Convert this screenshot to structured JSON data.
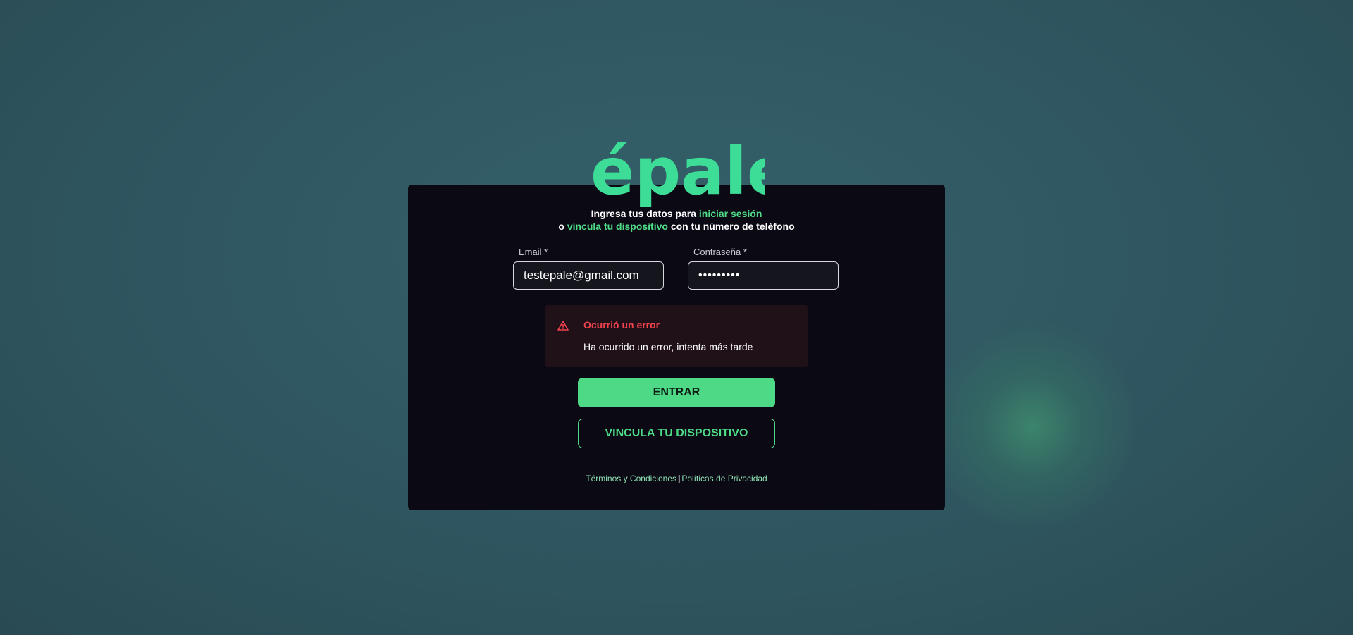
{
  "brand": {
    "logo_text": "épale",
    "accent_color": "#4ed987",
    "logo_color": "#3ddc97"
  },
  "subtitle": {
    "line1_prefix": "Ingresa tus datos para ",
    "line1_highlight": "iniciar sesión",
    "line2_prefix": "o ",
    "line2_highlight": "vincula tu dispositivo",
    "line2_suffix": " con tu número de teléfono"
  },
  "form": {
    "email_label": "Email *",
    "email_value": "testepale@gmail.com",
    "password_label": "Contraseña *",
    "password_value": "•••••••••"
  },
  "error": {
    "icon": "warning-triangle-icon",
    "title": "Ocurrió un error",
    "message": "Ha ocurrido un error, intenta más tarde",
    "color": "#f0434e"
  },
  "buttons": {
    "login_label": "ENTRAR",
    "link_device_label": "VINCULA TU DISPOSITIVO"
  },
  "footer": {
    "terms_label": "Términos y Condiciones",
    "separator": "|",
    "privacy_label": "Políticas de Privacidad"
  }
}
